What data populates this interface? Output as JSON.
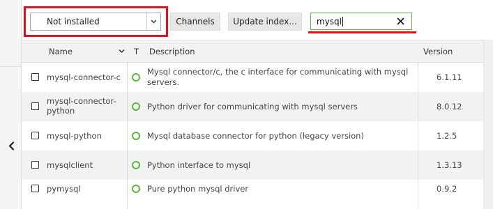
{
  "toolbar": {
    "filter_select_value": "Not installed",
    "channels_label": "Channels",
    "update_index_label": "Update index...",
    "search_value": "mysql"
  },
  "table": {
    "columns": {
      "name": "Name",
      "type": "T",
      "description": "Description",
      "version": "Version"
    },
    "rows": [
      {
        "name": "mysql-connector-c",
        "description": "Mysql connector/c, the c interface for communicating with mysql servers.",
        "version": "6.1.11"
      },
      {
        "name": "mysql-connector-python",
        "description": "Python driver for communicating with mysql servers",
        "version": "8.0.12"
      },
      {
        "name": "mysql-python",
        "description": "Mysql database connector for python (legacy version)",
        "version": "1.2.5"
      },
      {
        "name": "mysqlclient",
        "description": "Python interface to mysql",
        "version": "1.3.13"
      },
      {
        "name": "pymysql",
        "description": "Pure python mysql driver",
        "version": "0.9.2"
      }
    ]
  },
  "colors": {
    "highlight": "#e3101b",
    "status_green": "#5cb83a",
    "search_border": "#69b34c"
  },
  "icons": {
    "collapse": "chevron-left-icon",
    "select_caret": "chevron-down-icon",
    "sort": "chevron-down-icon",
    "clear": "close-icon",
    "status": "status-ring-icon"
  }
}
